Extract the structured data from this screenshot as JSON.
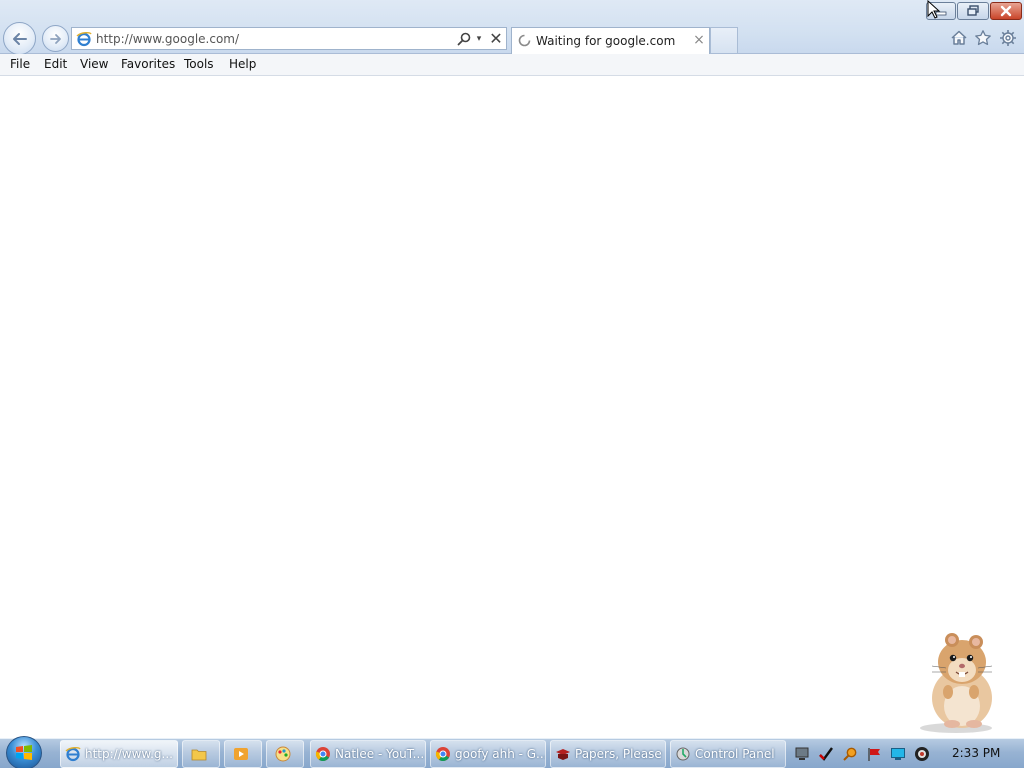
{
  "browser": {
    "address_url": "http://www.google.com/",
    "tab_title": "Waiting for google.com",
    "tab_close_glyph": "×",
    "stop_glyph": "✕",
    "dropdown_glyph": "▾"
  },
  "menu": {
    "items": [
      "File",
      "Edit",
      "View",
      "Favorites",
      "Tools",
      "Help"
    ]
  },
  "icons": {
    "back": "back-arrow-icon",
    "forward": "forward-arrow-icon",
    "page": "ie-page-icon",
    "search": "search-icon",
    "home": "home-icon",
    "favorites": "star-icon",
    "tools": "gear-icon",
    "minimize": "minimize-icon",
    "maximize": "restore-icon",
    "close": "close-icon",
    "desktop_buddy": "hamster-icon"
  },
  "taskbar": {
    "clock": "2:33 PM",
    "buttons": [
      {
        "label": "http://www.g...",
        "icon": "ie-icon",
        "active": true
      },
      {
        "label": "",
        "icon": "folder-icon",
        "active": false
      },
      {
        "label": "",
        "icon": "media-player-icon",
        "active": false
      },
      {
        "label": "",
        "icon": "paint-app-icon",
        "active": false
      },
      {
        "label": "Natlee - YouT...",
        "icon": "chrome-icon",
        "active": false
      },
      {
        "label": "goofy ahh - G...",
        "icon": "chrome-icon",
        "active": false
      },
      {
        "label": "Papers, Please",
        "icon": "papers-please-icon",
        "active": false
      },
      {
        "label": "Control Panel",
        "icon": "control-panel-icon",
        "active": false
      }
    ],
    "tray_icons": [
      "network-icon",
      "check-icon",
      "search-tray-icon",
      "flag-icon",
      "monitor-icon",
      "volume-icon"
    ]
  },
  "colors": {
    "accent": "#3a8fd6",
    "close": "#c9452a",
    "content_bg": "#ffffff"
  }
}
